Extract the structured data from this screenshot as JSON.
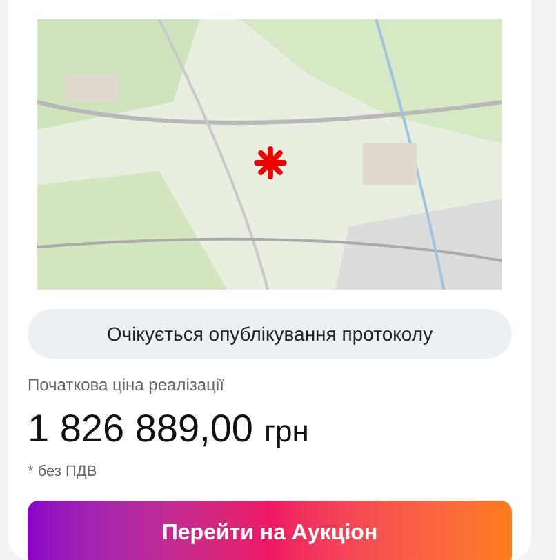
{
  "status": {
    "label": "Очікується опублікування протоколу"
  },
  "price": {
    "label": "Початкова ціна реалізації",
    "amount": "1 826 889,00",
    "currency": "грн",
    "note": "* без ПДВ"
  },
  "action_button": {
    "label": "Перейти на Аукціон"
  }
}
